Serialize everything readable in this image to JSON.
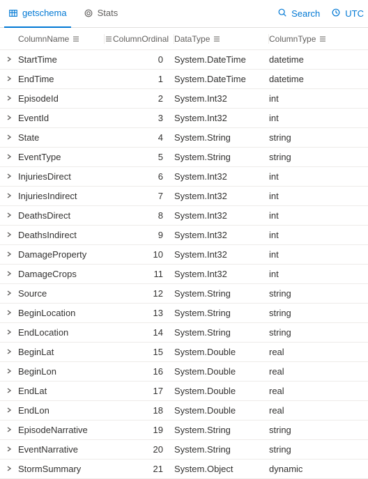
{
  "header": {
    "tabs": [
      {
        "id": "getschema",
        "label": "getschema",
        "icon": "table-icon",
        "active": true
      },
      {
        "id": "stats",
        "label": "Stats",
        "icon": "target-icon",
        "active": false
      }
    ],
    "actions": [
      {
        "id": "search",
        "label": "Search",
        "icon": "search-icon"
      },
      {
        "id": "utc",
        "label": "UTC",
        "icon": "clock-icon"
      }
    ]
  },
  "columns": [
    {
      "key": "ColumnName",
      "label": "ColumnName",
      "align": "left"
    },
    {
      "key": "ColumnOrdinal",
      "label": "ColumnOrdinal",
      "align": "right"
    },
    {
      "key": "DataType",
      "label": "DataType",
      "align": "left"
    },
    {
      "key": "ColumnType",
      "label": "ColumnType",
      "align": "left"
    }
  ],
  "rows": [
    {
      "ColumnName": "StartTime",
      "ColumnOrdinal": 0,
      "DataType": "System.DateTime",
      "ColumnType": "datetime"
    },
    {
      "ColumnName": "EndTime",
      "ColumnOrdinal": 1,
      "DataType": "System.DateTime",
      "ColumnType": "datetime"
    },
    {
      "ColumnName": "EpisodeId",
      "ColumnOrdinal": 2,
      "DataType": "System.Int32",
      "ColumnType": "int"
    },
    {
      "ColumnName": "EventId",
      "ColumnOrdinal": 3,
      "DataType": "System.Int32",
      "ColumnType": "int"
    },
    {
      "ColumnName": "State",
      "ColumnOrdinal": 4,
      "DataType": "System.String",
      "ColumnType": "string"
    },
    {
      "ColumnName": "EventType",
      "ColumnOrdinal": 5,
      "DataType": "System.String",
      "ColumnType": "string"
    },
    {
      "ColumnName": "InjuriesDirect",
      "ColumnOrdinal": 6,
      "DataType": "System.Int32",
      "ColumnType": "int"
    },
    {
      "ColumnName": "InjuriesIndirect",
      "ColumnOrdinal": 7,
      "DataType": "System.Int32",
      "ColumnType": "int"
    },
    {
      "ColumnName": "DeathsDirect",
      "ColumnOrdinal": 8,
      "DataType": "System.Int32",
      "ColumnType": "int"
    },
    {
      "ColumnName": "DeathsIndirect",
      "ColumnOrdinal": 9,
      "DataType": "System.Int32",
      "ColumnType": "int"
    },
    {
      "ColumnName": "DamageProperty",
      "ColumnOrdinal": 10,
      "DataType": "System.Int32",
      "ColumnType": "int"
    },
    {
      "ColumnName": "DamageCrops",
      "ColumnOrdinal": 11,
      "DataType": "System.Int32",
      "ColumnType": "int"
    },
    {
      "ColumnName": "Source",
      "ColumnOrdinal": 12,
      "DataType": "System.String",
      "ColumnType": "string"
    },
    {
      "ColumnName": "BeginLocation",
      "ColumnOrdinal": 13,
      "DataType": "System.String",
      "ColumnType": "string"
    },
    {
      "ColumnName": "EndLocation",
      "ColumnOrdinal": 14,
      "DataType": "System.String",
      "ColumnType": "string"
    },
    {
      "ColumnName": "BeginLat",
      "ColumnOrdinal": 15,
      "DataType": "System.Double",
      "ColumnType": "real"
    },
    {
      "ColumnName": "BeginLon",
      "ColumnOrdinal": 16,
      "DataType": "System.Double",
      "ColumnType": "real"
    },
    {
      "ColumnName": "EndLat",
      "ColumnOrdinal": 17,
      "DataType": "System.Double",
      "ColumnType": "real"
    },
    {
      "ColumnName": "EndLon",
      "ColumnOrdinal": 18,
      "DataType": "System.Double",
      "ColumnType": "real"
    },
    {
      "ColumnName": "EpisodeNarrative",
      "ColumnOrdinal": 19,
      "DataType": "System.String",
      "ColumnType": "string"
    },
    {
      "ColumnName": "EventNarrative",
      "ColumnOrdinal": 20,
      "DataType": "System.String",
      "ColumnType": "string"
    },
    {
      "ColumnName": "StormSummary",
      "ColumnOrdinal": 21,
      "DataType": "System.Object",
      "ColumnType": "dynamic"
    }
  ]
}
